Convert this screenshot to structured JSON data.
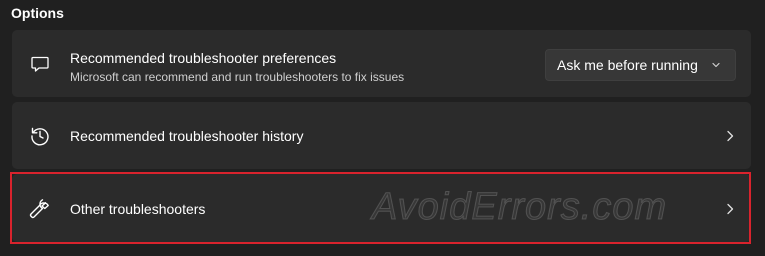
{
  "section": {
    "title": "Options"
  },
  "cards": [
    {
      "title": "Recommended troubleshooter preferences",
      "description": "Microsoft can recommend and run troubleshooters to fix issues",
      "icon": "chat-bubble-icon",
      "dropdown": {
        "value": "Ask me before running"
      }
    },
    {
      "title": "Recommended troubleshooter history",
      "icon": "history-icon"
    },
    {
      "title": "Other troubleshooters",
      "icon": "wrench-icon"
    }
  ],
  "watermark": "AvoidErrors.com",
  "colors": {
    "background": "#202020",
    "card": "#2b2b2b",
    "dropdown": "#373737",
    "highlight": "#d9232d"
  }
}
